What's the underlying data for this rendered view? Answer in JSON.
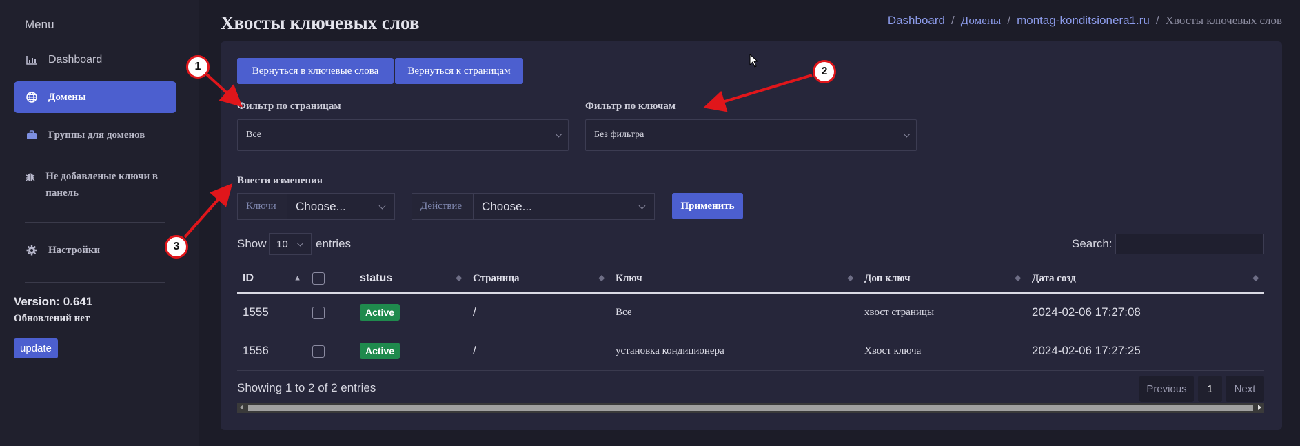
{
  "sidebar": {
    "menu_title": "Menu",
    "items": [
      {
        "label": "Dashboard",
        "icon": "chart-bar-icon"
      },
      {
        "label": "Домены",
        "icon": "globe-icon"
      },
      {
        "label": "Группы для доменов",
        "icon": "briefcase-icon"
      },
      {
        "label": "Не добавленые ключи в панель",
        "icon": "bug-icon"
      },
      {
        "label": "Настройки",
        "icon": "gear-icon"
      }
    ],
    "version": "Version: 0.641",
    "updates_status": "Обновлений нет",
    "update_button": "update"
  },
  "header": {
    "title": "Хвосты ключевых слов",
    "breadcrumb": [
      "Dashboard",
      "Домены",
      "montag-konditsionera1.ru",
      "Хвосты ключевых слов"
    ]
  },
  "buttons": {
    "back_keywords": "Вернуться в ключевые слова",
    "back_pages": "Вернуться к страницам",
    "apply": "Применить"
  },
  "filters": {
    "pages_label": "Фильтр по страницам",
    "pages_value": "Все",
    "keys_label": "Фильтр по ключам",
    "keys_value": "Без фильтра"
  },
  "changes": {
    "label": "Внести изменения",
    "keys_prefix": "Ключи",
    "keys_select": "Choose...",
    "action_prefix": "Действие",
    "action_select": "Choose..."
  },
  "datatable": {
    "show_label": "Show",
    "length_value": "10",
    "entries_label": "entries",
    "search_label": "Search:",
    "columns": [
      "ID",
      "",
      "status",
      "Страница",
      "Ключ",
      "Доп ключ",
      "Дата созд"
    ],
    "rows": [
      {
        "id": "1555",
        "status": "Active",
        "page": "/",
        "key": "Все",
        "extra_key": "хвост страницы",
        "date": "2024-02-06 17:27:08"
      },
      {
        "id": "1556",
        "status": "Active",
        "page": "/",
        "key": "установка кондиционера",
        "extra_key": "Хвост ключа",
        "date": "2024-02-06 17:27:25"
      }
    ],
    "info": "Showing 1 to 2 of 2 entries",
    "pagination": {
      "previous": "Previous",
      "current": "1",
      "next": "Next"
    }
  },
  "annotations": [
    "1",
    "2",
    "3"
  ],
  "colors": {
    "accent": "#4c5fcf",
    "active_badge": "#1f8a4d",
    "annotation_red": "#e0161b"
  }
}
